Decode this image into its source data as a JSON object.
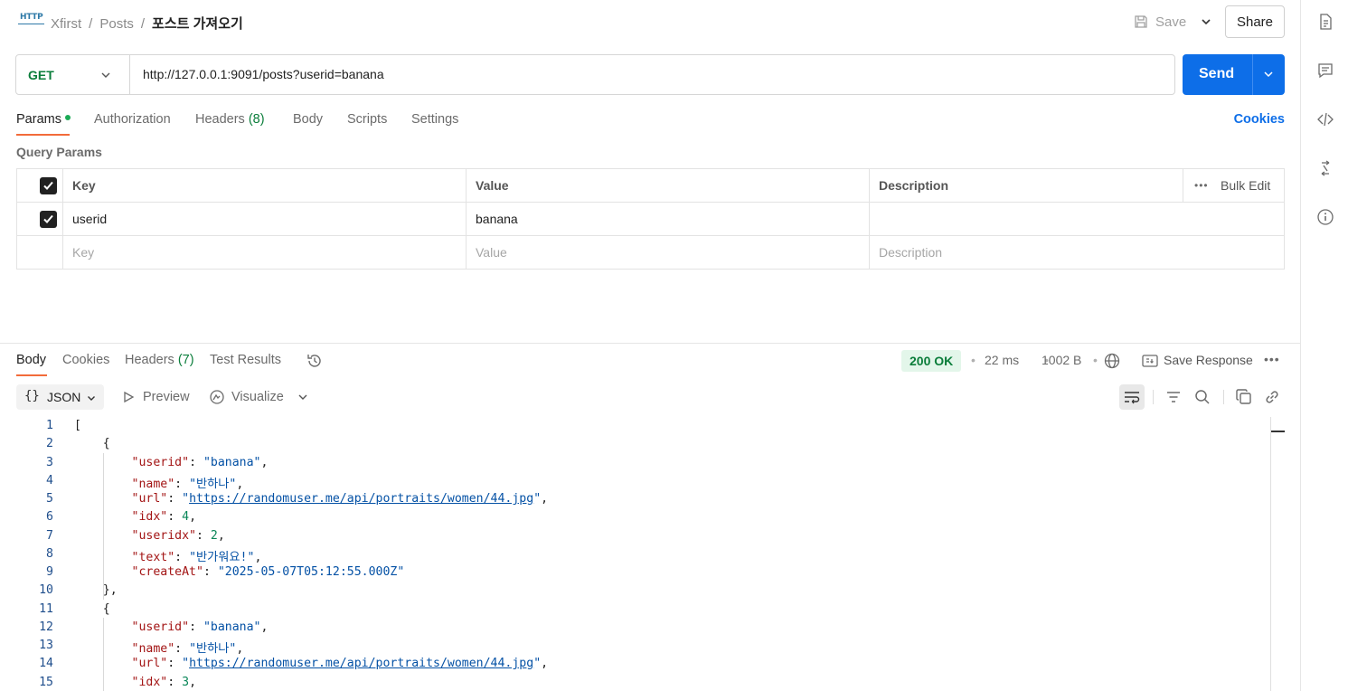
{
  "header": {
    "breadcrumbs": [
      "Xfirst",
      "Posts"
    ],
    "separator": "/",
    "current": "포스트 가져오기",
    "save_label": "Save",
    "share_label": "Share",
    "http_icon_text": "HTTP"
  },
  "request": {
    "method": "GET",
    "url": "http://127.0.0.1:9091/posts?userid=banana",
    "send_label": "Send"
  },
  "request_tabs": {
    "params": "Params",
    "authorization": "Authorization",
    "headers": "Headers",
    "headers_count": "(8)",
    "body": "Body",
    "scripts": "Scripts",
    "settings": "Settings",
    "cookies": "Cookies"
  },
  "query_params": {
    "title": "Query Params",
    "columns": {
      "key": "Key",
      "value": "Value",
      "description": "Description"
    },
    "bulk_edit": "Bulk Edit",
    "rows": [
      {
        "key": "userid",
        "value": "banana",
        "description": "",
        "checked": true
      }
    ],
    "placeholders": {
      "key": "Key",
      "value": "Value",
      "description": "Description"
    }
  },
  "response_tabs": {
    "body": "Body",
    "cookies": "Cookies",
    "headers": "Headers",
    "headers_count": "(7)",
    "test_results": "Test Results"
  },
  "response_meta": {
    "status": "200 OK",
    "time": "22 ms",
    "size": "1002 B",
    "save_response": "Save Response"
  },
  "response_toolbar": {
    "format_braces": "{}",
    "format": "JSON",
    "preview": "Preview",
    "visualize": "Visualize"
  },
  "code_lines": [
    {
      "n": "1"
    },
    {
      "n": "2"
    },
    {
      "n": "3"
    },
    {
      "n": "4"
    },
    {
      "n": "5"
    },
    {
      "n": "6"
    },
    {
      "n": "7"
    },
    {
      "n": "8"
    },
    {
      "n": "9"
    },
    {
      "n": "10"
    },
    {
      "n": "11"
    },
    {
      "n": "12"
    },
    {
      "n": "13"
    },
    {
      "n": "14"
    },
    {
      "n": "15"
    }
  ],
  "json_body": {
    "post1": {
      "userid": "banana",
      "name": "반하나",
      "url": "https://randomuser.me/api/portraits/women/44.jpg",
      "idx": "4",
      "useridx": "2",
      "text": "반가워요!",
      "createAt": "2025-05-07T05:12:55.000Z"
    },
    "post2": {
      "userid": "banana",
      "name": "반하나",
      "url": "https://randomuser.me/api/portraits/women/44.jpg",
      "idx": "3"
    }
  },
  "colors": {
    "accent": "#0d6ee8",
    "method_get": "#0a7d3a",
    "active_tab": "#f26b3a",
    "status_ok_bg": "#e3f6ea"
  }
}
